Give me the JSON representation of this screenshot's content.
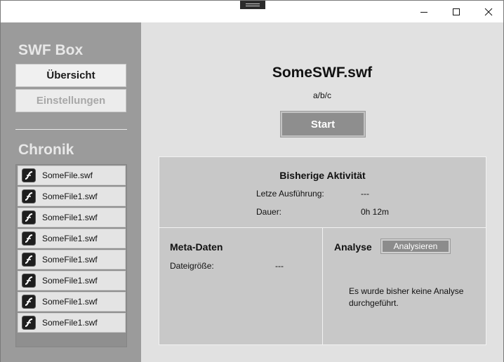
{
  "window": {
    "controls": {
      "minimize_icon": "minimize-icon",
      "maximize_icon": "maximize-icon",
      "close_icon": "close-icon"
    }
  },
  "sidebar": {
    "brand": "SWF Box",
    "nav": {
      "overview": "Übersicht",
      "settings": "Einstellungen"
    },
    "history_title": "Chronik",
    "history": [
      {
        "label": "SomeFile.swf",
        "icon": "swf-file-icon"
      },
      {
        "label": "SomeFile1.swf",
        "icon": "swf-file-icon"
      },
      {
        "label": "SomeFile1.swf",
        "icon": "swf-file-icon"
      },
      {
        "label": "SomeFile1.swf",
        "icon": "swf-file-icon"
      },
      {
        "label": "SomeFile1.swf",
        "icon": "swf-file-icon"
      },
      {
        "label": "SomeFile1.swf",
        "icon": "swf-file-icon"
      },
      {
        "label": "SomeFile1.swf",
        "icon": "swf-file-icon"
      },
      {
        "label": "SomeFile1.swf",
        "icon": "swf-file-icon"
      }
    ]
  },
  "main": {
    "file_name": "SomeSWF.swf",
    "path": "a/b/c",
    "start_label": "Start",
    "activity": {
      "title": "Bisherige Aktivität",
      "last_run_label": "Letze Ausführung:",
      "last_run_value": "---",
      "duration_label": "Dauer:",
      "duration_value": "0h 12m"
    },
    "meta": {
      "title": "Meta-Daten",
      "size_label": "Dateigröße:",
      "size_value": "---"
    },
    "analysis": {
      "title": "Analyse",
      "button_label": "Analysieren",
      "message": "Es wurde bisher keine Analyse durchgeführt."
    }
  },
  "colors": {
    "sidebar_bg": "#9b9b9b",
    "main_bg": "#e1e1e1",
    "panel_bg": "#c8c8c8",
    "button_bg": "#8e8e8e"
  }
}
